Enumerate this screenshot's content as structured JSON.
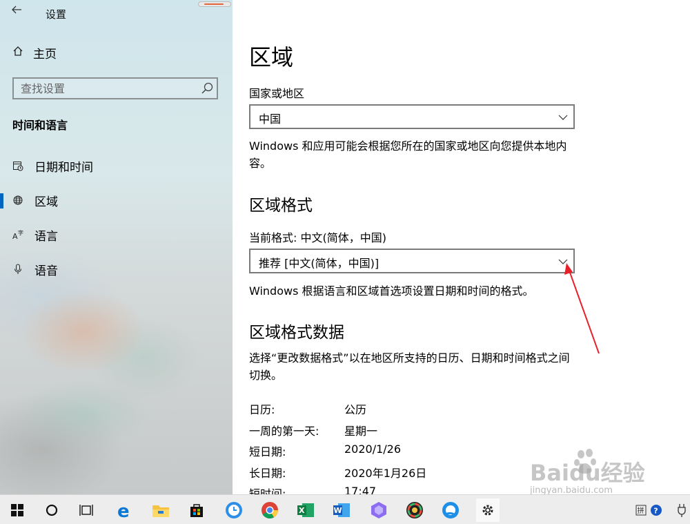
{
  "sidebar": {
    "title": "设置",
    "home_label": "主页",
    "search_placeholder": "查找设置",
    "section_title": "时间和语言",
    "items": [
      {
        "label": "日期和时间"
      },
      {
        "label": "区域"
      },
      {
        "label": "语言"
      },
      {
        "label": "语音"
      }
    ],
    "active_item": "区域"
  },
  "main": {
    "title": "区域",
    "country_label": "国家或地区",
    "country_value": "中国",
    "country_desc": "Windows 和应用可能会根据您所在的国家或地区向您提供本地内容。",
    "format_heading": "区域格式",
    "current_format": "当前格式: 中文(简体，中国)",
    "format_value": "推荐 [中文(简体，中国)]",
    "format_desc": "Windows 根据语言和区域首选项设置日期和时间的格式。",
    "data_heading": "区域格式数据",
    "data_desc": "选择“更改数据格式”以在地区所支持的日历、日期和时间格式之间切换。",
    "rows": [
      {
        "key": "日历:",
        "value": "公历"
      },
      {
        "key": "一周的第一天:",
        "value": "星期一"
      },
      {
        "key": "短日期:",
        "value": "2020/1/26"
      },
      {
        "key": "长日期:",
        "value": "2020年1月26日"
      },
      {
        "key": "短时间:",
        "value": "17:47"
      }
    ]
  },
  "watermark": {
    "brand": "Baidu经验",
    "url": "jingyan.baidu.com"
  },
  "taskbar": {
    "apps": [
      "start-icon",
      "cortana-icon",
      "task-view-icon",
      "edge-icon",
      "file-explorer-icon",
      "store-icon",
      "clock-app-icon",
      "chrome-icon",
      "excel-icon",
      "word-icon",
      "app-icon",
      "color-app-icon",
      "browser-app-icon",
      "settings-icon"
    ],
    "tray": [
      "ime-icon",
      "help-icon",
      "plug-icon"
    ]
  },
  "colors": {
    "accent": "#0067c0",
    "annotation_arrow": "#e8202a"
  }
}
